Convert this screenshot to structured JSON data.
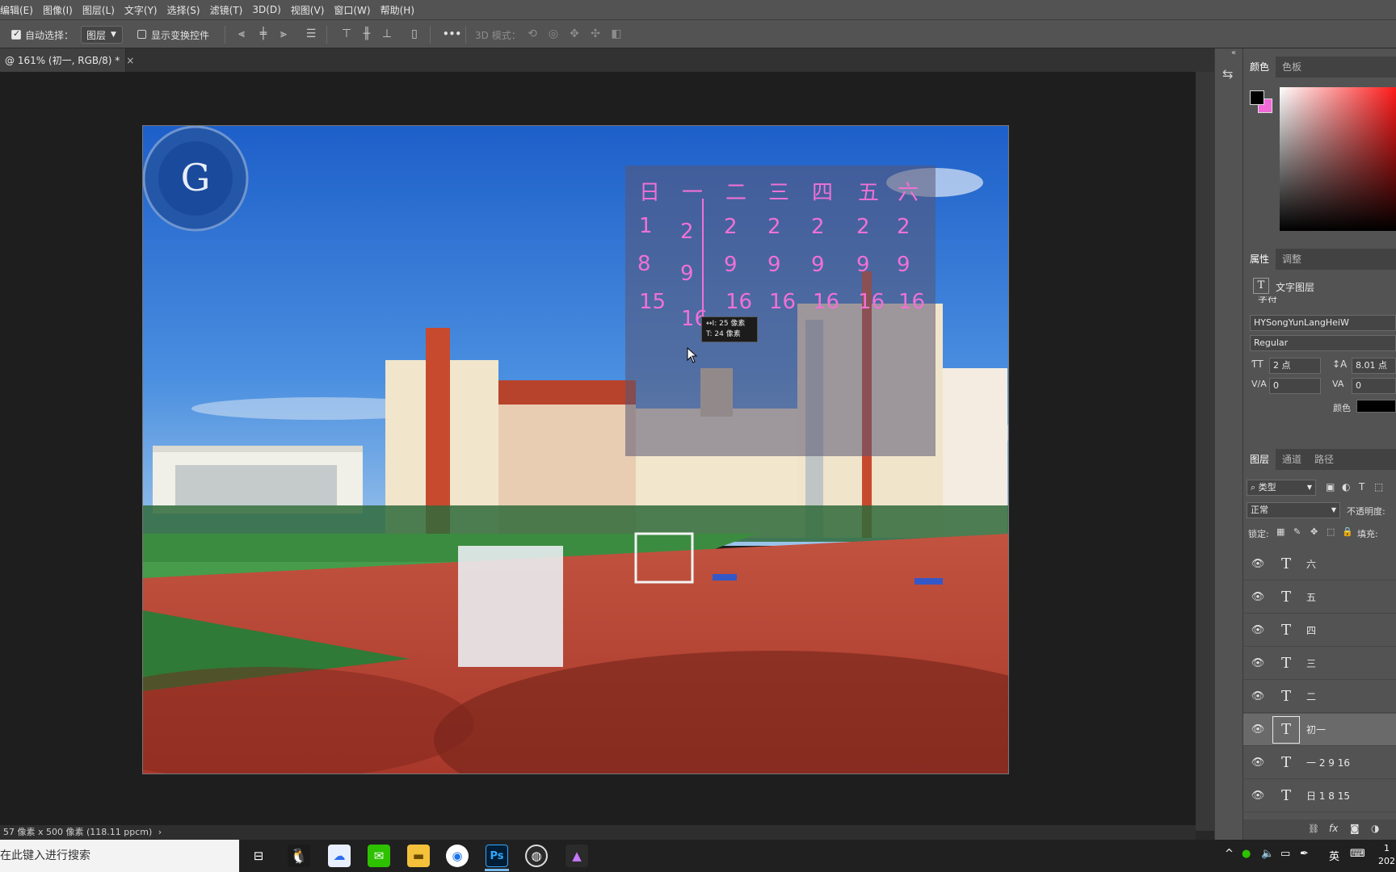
{
  "menu": [
    "编辑(E)",
    "图像(I)",
    "图层(L)",
    "文字(Y)",
    "选择(S)",
    "滤镜(T)",
    "3D(D)",
    "视图(V)",
    "窗口(W)",
    "帮助(H)"
  ],
  "options": {
    "auto_select_label": "自动选择：",
    "auto_select_value": "图层",
    "show_transform_label": "显示变换控件",
    "more_label": "•••",
    "mode3d_label": "3D 模式："
  },
  "document": {
    "tab_title": "@ 161% (初一, RGB/8) *",
    "close_glyph": "×",
    "status_text": "57 像素 x 500 像素 (118.11 ppcm)",
    "status_arrow": "›"
  },
  "calendar": {
    "weekdays": [
      "日",
      "一",
      "二",
      "三",
      "四",
      "五",
      "六"
    ],
    "col0": [
      "1",
      "8",
      "15"
    ],
    "col1": [
      "2",
      "9",
      "16"
    ],
    "col2": [
      "2",
      "9",
      "16"
    ],
    "col3": [
      "2",
      "9",
      "16"
    ],
    "col4": [
      "2",
      "9",
      "16"
    ],
    "col5": [
      "2",
      "9",
      "16"
    ],
    "col6": [
      "2",
      "9",
      "16"
    ]
  },
  "tooltip": {
    "line1": "↔I: 25 像素",
    "line2": "T: 24 像素"
  },
  "panels": {
    "color_tabs": [
      "颜色",
      "色板"
    ],
    "props_tabs": [
      "属性",
      "调整"
    ],
    "props_title": "文字图层",
    "props_partial": "字符",
    "font_family": "HYSongYunLangHeiW",
    "font_style": "Regular",
    "font_size": "2 点",
    "leading": "8.01 点",
    "tracking_va": "0",
    "tracking": "0",
    "color_label": "颜色",
    "layers_tabs": [
      "图层",
      "通道",
      "路径"
    ],
    "filter_label": "类型",
    "blend_mode": "正常",
    "opacity_label": "不透明度:",
    "lock_label": "锁定:",
    "fill_label": "填充:",
    "layers": [
      {
        "name": "六",
        "selected": false
      },
      {
        "name": "五",
        "selected": false
      },
      {
        "name": "四",
        "selected": false
      },
      {
        "name": "三",
        "selected": false
      },
      {
        "name": "二",
        "selected": false
      },
      {
        "name": "初一",
        "selected": true
      },
      {
        "name": "一 2 9 16",
        "selected": false
      },
      {
        "name": "日 1 8 15",
        "selected": false
      }
    ]
  },
  "taskbar": {
    "search_placeholder": "在此键入进行搜索",
    "ps_label": "Ps",
    "ime_label": "英",
    "clock_line1": "1",
    "clock_line2": "202"
  },
  "colors": {
    "calendar_text": "#f071d6",
    "foreground": "#000000",
    "background": "#f06ad8",
    "panel_bg": "#535353"
  }
}
